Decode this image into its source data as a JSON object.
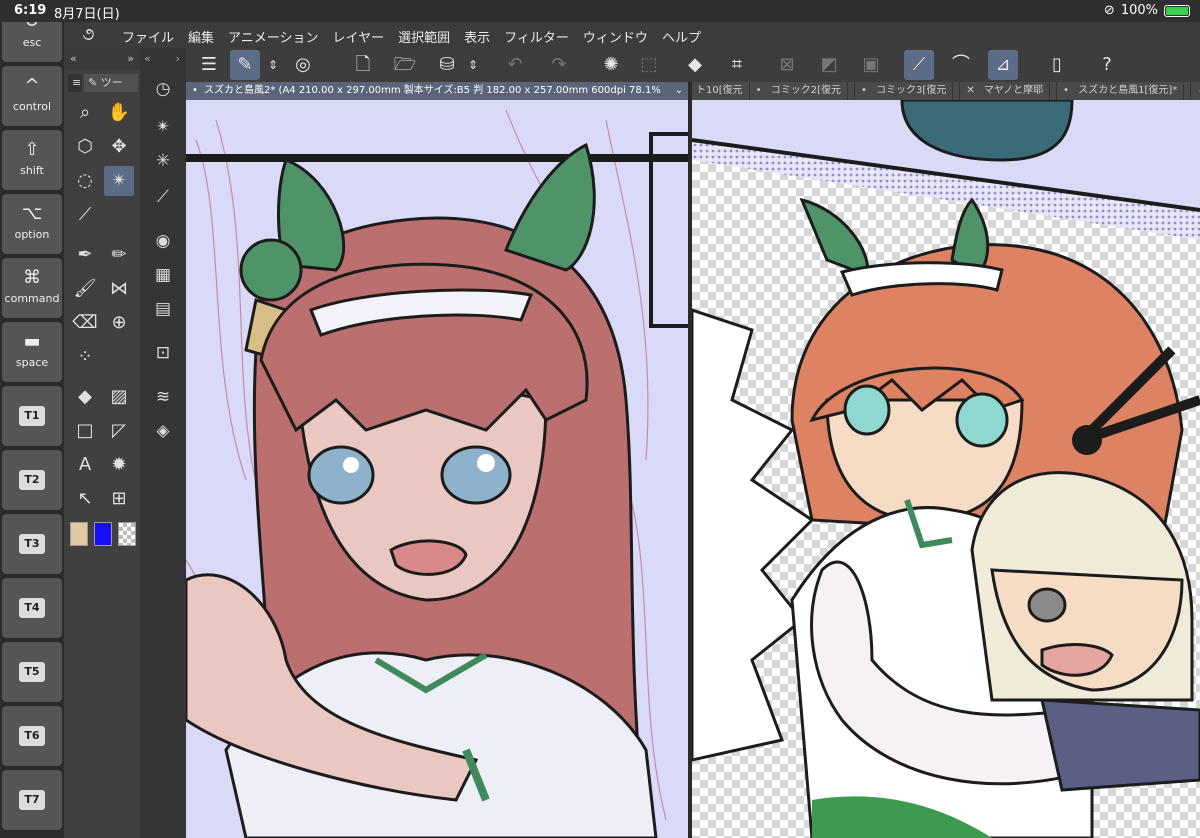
{
  "status_bar": {
    "time": "6:19",
    "date": "8月7日(日)",
    "battery": "100%"
  },
  "keys": [
    {
      "glyph": "↺",
      "label": "esc"
    },
    {
      "glyph": "^",
      "label": "control"
    },
    {
      "glyph": "⇧",
      "label": "shift"
    },
    {
      "glyph": "⌥",
      "label": "option"
    },
    {
      "glyph": "⌘",
      "label": "command"
    },
    {
      "glyph": "▬",
      "label": "space"
    },
    {
      "t": "T1"
    },
    {
      "t": "T2"
    },
    {
      "t": "T3"
    },
    {
      "t": "T4"
    },
    {
      "t": "T5"
    },
    {
      "t": "T6"
    },
    {
      "t": "T7"
    }
  ],
  "menu": {
    "items": [
      "ファイル",
      "編集",
      "アニメーション",
      "レイヤー",
      "選択範囲",
      "表示",
      "フィルター",
      "ウィンドウ",
      "ヘルプ"
    ]
  },
  "tool_panel": {
    "tab_label": "ツー"
  },
  "documents": {
    "active_tab": "スズカと島風2* (A4 210.00 x 297.00mm 製本サイズ:B5 判 182.00 x 257.00mm 600dpi 78.1%",
    "other_tabs": [
      "ト10[復元",
      "コミック2[復元",
      "コミック3[復元",
      "マヤノと摩耶",
      "スズカと島風1[復元]*"
    ]
  },
  "colors": {
    "main_color": "#e3c9a0",
    "sub_color": "#1a0dff",
    "accent_selected": "#5c6b86",
    "canvas_left_bg": "#d9d9f8"
  }
}
